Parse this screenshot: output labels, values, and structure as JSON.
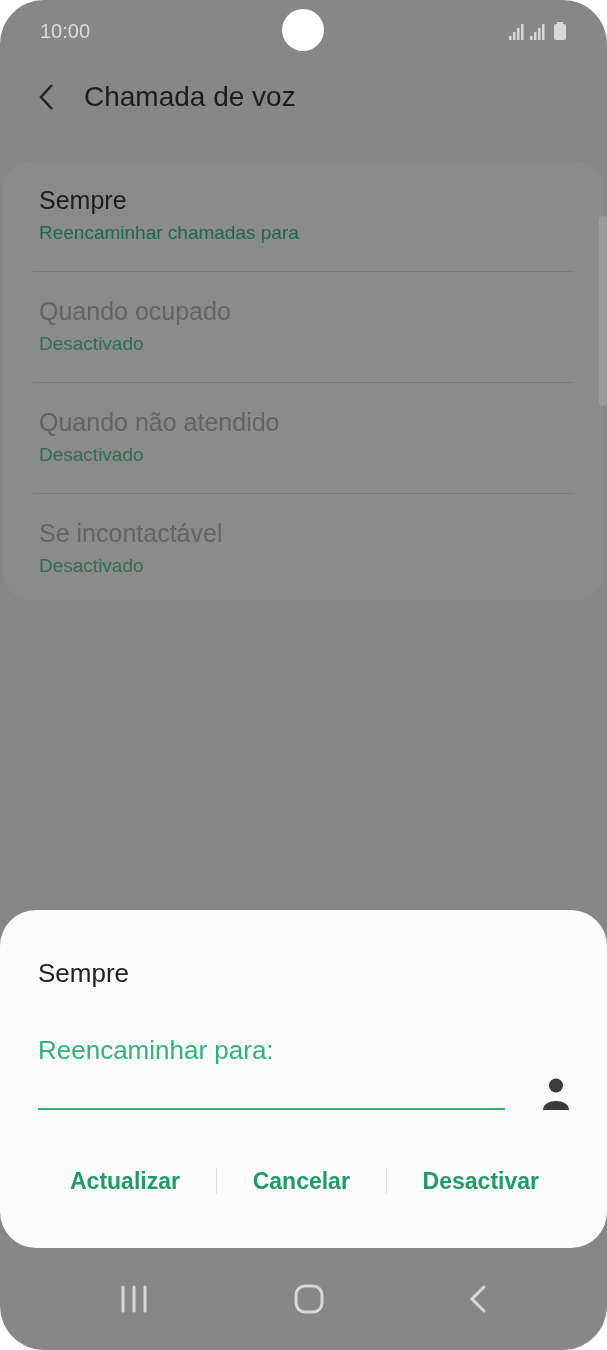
{
  "status_bar": {
    "time": "10:00"
  },
  "header": {
    "title": "Chamada de voz"
  },
  "items": [
    {
      "title": "Sempre",
      "subtitle": "Reencaminhar chamadas para",
      "disabled": false
    },
    {
      "title": "Quando ocupado",
      "subtitle": "Desactivado",
      "disabled": true
    },
    {
      "title": "Quando não atendido",
      "subtitle": "Desactivado",
      "disabled": true
    },
    {
      "title": "Se incontactável",
      "subtitle": "Desactivado",
      "disabled": true
    }
  ],
  "dialog": {
    "title": "Sempre",
    "field_label": "Reencaminhar para:",
    "buttons": [
      "Actualizar",
      "Cancelar",
      "Desactivar"
    ]
  }
}
